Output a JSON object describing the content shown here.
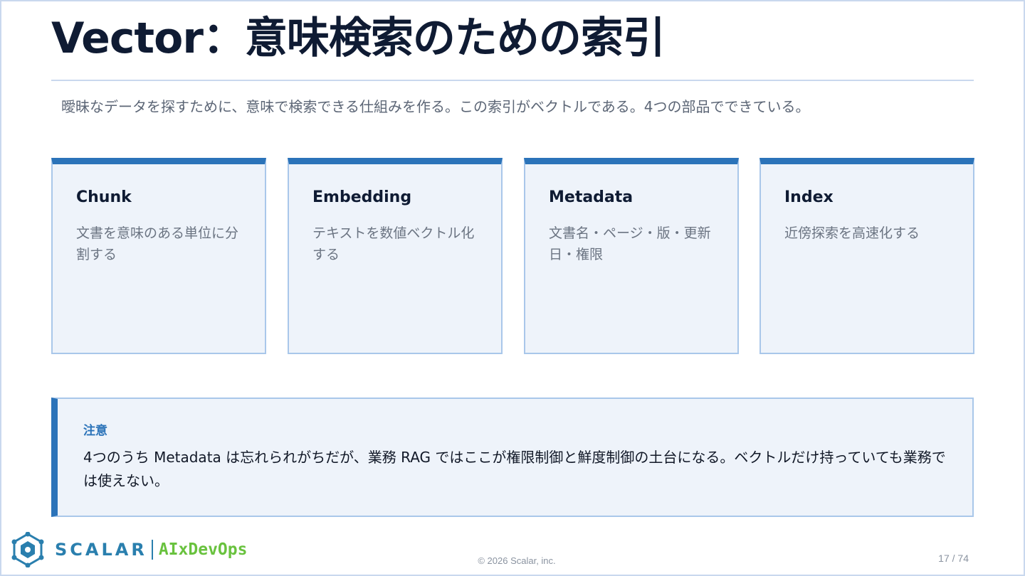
{
  "slide": {
    "title": "Vector：意味検索のための索引",
    "subtitle": "曖昧なデータを探すために、意味で検索できる仕組みを作る。この索引がベクトルである。4つの部品でできている。"
  },
  "cards": [
    {
      "title": "Chunk",
      "text": "文書を意味のある単位に分割する"
    },
    {
      "title": "Embedding",
      "text": "テキストを数値ベクトル化する"
    },
    {
      "title": "Metadata",
      "text": "文書名・ページ・版・更新日・権限"
    },
    {
      "title": "Index",
      "text": "近傍探索を高速化する"
    }
  ],
  "note": {
    "label": "注意",
    "text": "4つのうち Metadata は忘れられがちだが、業務 RAG ではここが権限制御と鮮度制御の土台になる。ベクトルだけ持っていても業務では使えない。"
  },
  "footer": {
    "logo_icon": "scalar-logo-icon",
    "brand": "SCALAR",
    "product": "AIxDevOps",
    "copyright": "© 2026 Scalar, inc.",
    "page": "17 / 74"
  },
  "colors": {
    "accent": "#2b73b9",
    "card_bg": "#eef3fa",
    "card_border": "#a9c7ea",
    "title": "#0f1b33",
    "brand_blue": "#2a7fae",
    "brand_green": "#69c23e"
  }
}
